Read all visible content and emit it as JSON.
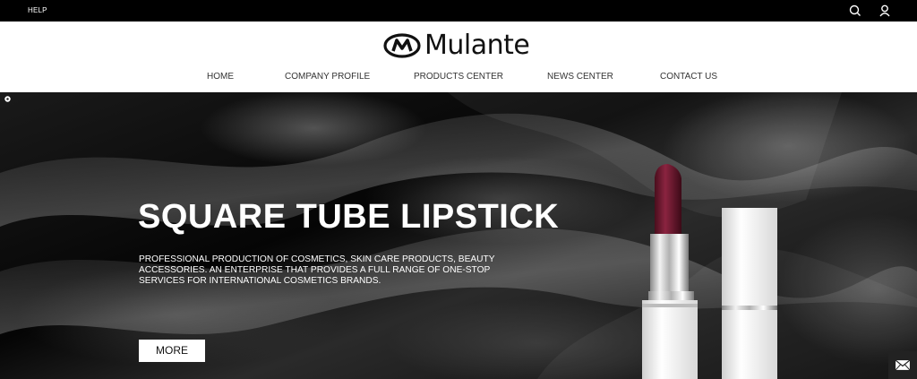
{
  "topbar": {
    "help_label": "HELP",
    "icons": [
      "search-icon",
      "user-icon"
    ]
  },
  "header": {
    "logo_text": "Mulante"
  },
  "nav": {
    "items": [
      {
        "label": "HOME"
      },
      {
        "label": "COMPANY PROFILE"
      },
      {
        "label": "PRODUCTS CENTER"
      },
      {
        "label": "NEWS CENTER"
      },
      {
        "label": "CONTACT US"
      }
    ]
  },
  "hero": {
    "title": "SQUARE TUBE LIPSTICK",
    "description": "PROFESSIONAL PRODUCTION OF COSMETICS, SKIN CARE PRODUCTS, BEAUTY ACCESSORIES. AN ENTERPRISE THAT PROVIDES A FULL RANGE OF ONE-STOP SERVICES FOR INTERNATIONAL COSMETICS BRANDS.",
    "more_label": "MORE"
  },
  "colors": {
    "topbar_bg": "#000000",
    "lipstick_color": "#7a1c34"
  }
}
